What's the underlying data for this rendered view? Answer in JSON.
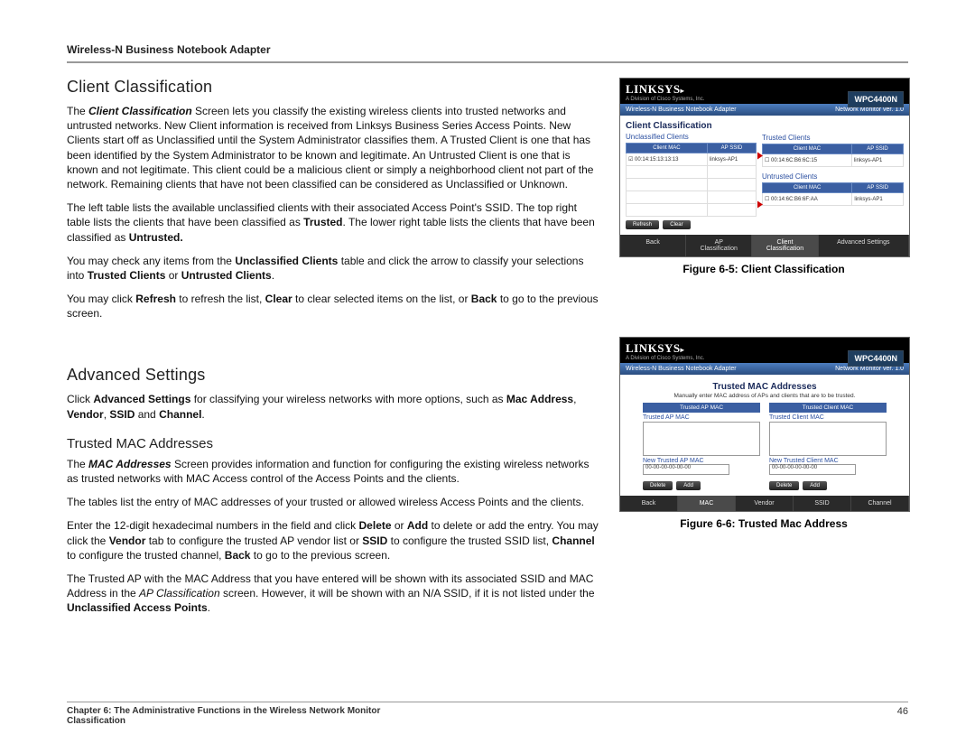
{
  "header": {
    "product": "Wireless-N Business Notebook Adapter"
  },
  "sections": {
    "s1_title": "Client Classification",
    "s2_title": "Advanced Settings",
    "s3_title": "Trusted MAC Addresses"
  },
  "paragraphs": {
    "p1a": "The ",
    "p1b": "Client Classification",
    "p1c": " Screen lets you classify the existing wireless clients into trusted networks and untrusted networks. New Client information is received from Linksys Business Series Access Points. New Clients start off as Unclassified until the System Administrator classifies them. A Trusted Client is one that has been identified by the System Administrator to be known and legitimate. An Untrusted Client is one that is known and not legitimate. This client could be a malicious client or simply a neighborhood client not part of the network. Remaining clients that have not been classified can be considered as Unclassified or Unknown.",
    "p2a": "The left table lists the available unclassified clients with their associated Access Point's SSID. The top right table lists the clients that have been classified as ",
    "p2b": "Trusted",
    "p2c": ". The lower right table lists the clients that have been classified as ",
    "p2d": "Untrusted.",
    "p3a": "You may check any items from the ",
    "p3b": "Unclassified Clients",
    "p3c": " table and click the arrow to classify your selections into ",
    "p3d": "Trusted Clients",
    "p3e": " or ",
    "p3f": "Untrusted Clients",
    "p3g": ".",
    "p4a": "You may click ",
    "p4b": "Refresh",
    "p4c": " to refresh the list, ",
    "p4d": "Clear",
    "p4e": " to clear selected items on the list, or ",
    "p4f": "Back",
    "p4g": " to go to the previous screen.",
    "p5a": "Click ",
    "p5b": "Advanced Settings",
    "p5c": " for classifying your wireless networks with more options, such as ",
    "p5d": "Mac Address",
    "p5e": ", ",
    "p5f": "Vendor",
    "p5g": ", ",
    "p5h": "SSID",
    "p5i": " and ",
    "p5j": "Channel",
    "p5k": ".",
    "p6a": "The ",
    "p6b": "MAC Addresses",
    "p6c": " Screen provides information and function for configuring the existing wireless networks as trusted networks with MAC Access control of the Access Points and the clients.",
    "p7": "The tables list the entry of MAC addresses of your trusted or allowed wireless Access Points and the clients.",
    "p8a": "Enter the 12-digit hexadecimal numbers in the field and click ",
    "p8b": "Delete",
    "p8c": " or ",
    "p8d": "Add",
    "p8e": " to delete or add the entry. You may click the ",
    "p8f": "Vendor",
    "p8g": " tab to configure the trusted AP vendor list or ",
    "p8h": "SSID",
    "p8i": " to configure the trusted SSID list, ",
    "p8j": "Channel",
    "p8k": " to configure the trusted channel, ",
    "p8l": "Back",
    "p8m": " to go to the previous screen.",
    "p9a": "The Trusted AP with the MAC Address that you have entered will be shown with its associated SSID and MAC Address in the ",
    "p9b": "AP Classification",
    "p9c": " screen. However, it will be shown with an N/A SSID, if it is not listed under the ",
    "p9d": "Unclassified Access Points",
    "p9e": "."
  },
  "figures": {
    "f5_caption": "Figure 6-5: Client Classification",
    "f6_caption": "Figure 6-6: Trusted Mac Address",
    "logo": "LINKSYS",
    "cisco": "A Division of Cisco Systems, Inc.",
    "model": "WPC4400N",
    "bar_left": "Wireless-N Business Notebook Adapter",
    "bar_right": "Network Monitor  ver. 1.0",
    "cc_title": "Client Classification",
    "cc_unclassified": "Unclassified Clients",
    "cc_trusted": "Trusted Clients",
    "cc_untrusted": "Untrusted Clients",
    "th_mac": "Client MAC",
    "th_ssid": "AP SSID",
    "row_unc_mac": "00:14:15:13:13:13",
    "row_unc_ssid": "linksys-AP1",
    "row_tr_mac": "00:14:6C:B6:6C:15",
    "row_tr_ssid": "linksys-AP1",
    "row_un_mac": "00:14:6C:B6:6F:AA",
    "row_un_ssid": "linksys-AP1",
    "btn_refresh": "Refresh",
    "btn_clear": "Clear",
    "tab_back": "Back",
    "tab_ap": "AP\nClassification",
    "tab_client": "Client\nClassification",
    "tab_adv": "Advanced Settings",
    "mac_title": "Trusted MAC Addresses",
    "mac_sub": "Manually enter MAC address of APs and clients that are to be trusted.",
    "mac_h_ap": "Trusted AP MAC",
    "mac_h_cl": "Trusted Client MAC",
    "mac_lbl_ap": "Trusted AP MAC",
    "mac_lbl_cl": "Trusted Client MAC",
    "mac_new_ap": "New Trusted AP MAC",
    "mac_new_cl": "New Trusted Client MAC",
    "mac_default": "00-00-00-00-00-00",
    "btn_delete": "Delete",
    "btn_add": "Add",
    "tab_mac": "MAC",
    "tab_vendor": "Vendor",
    "tab_ssid": "SSID",
    "tab_channel": "Channel"
  },
  "footer": {
    "left1": "Chapter 6: The Administrative Functions in the Wireless Network Monitor",
    "left2": "Classification",
    "page": "46"
  }
}
